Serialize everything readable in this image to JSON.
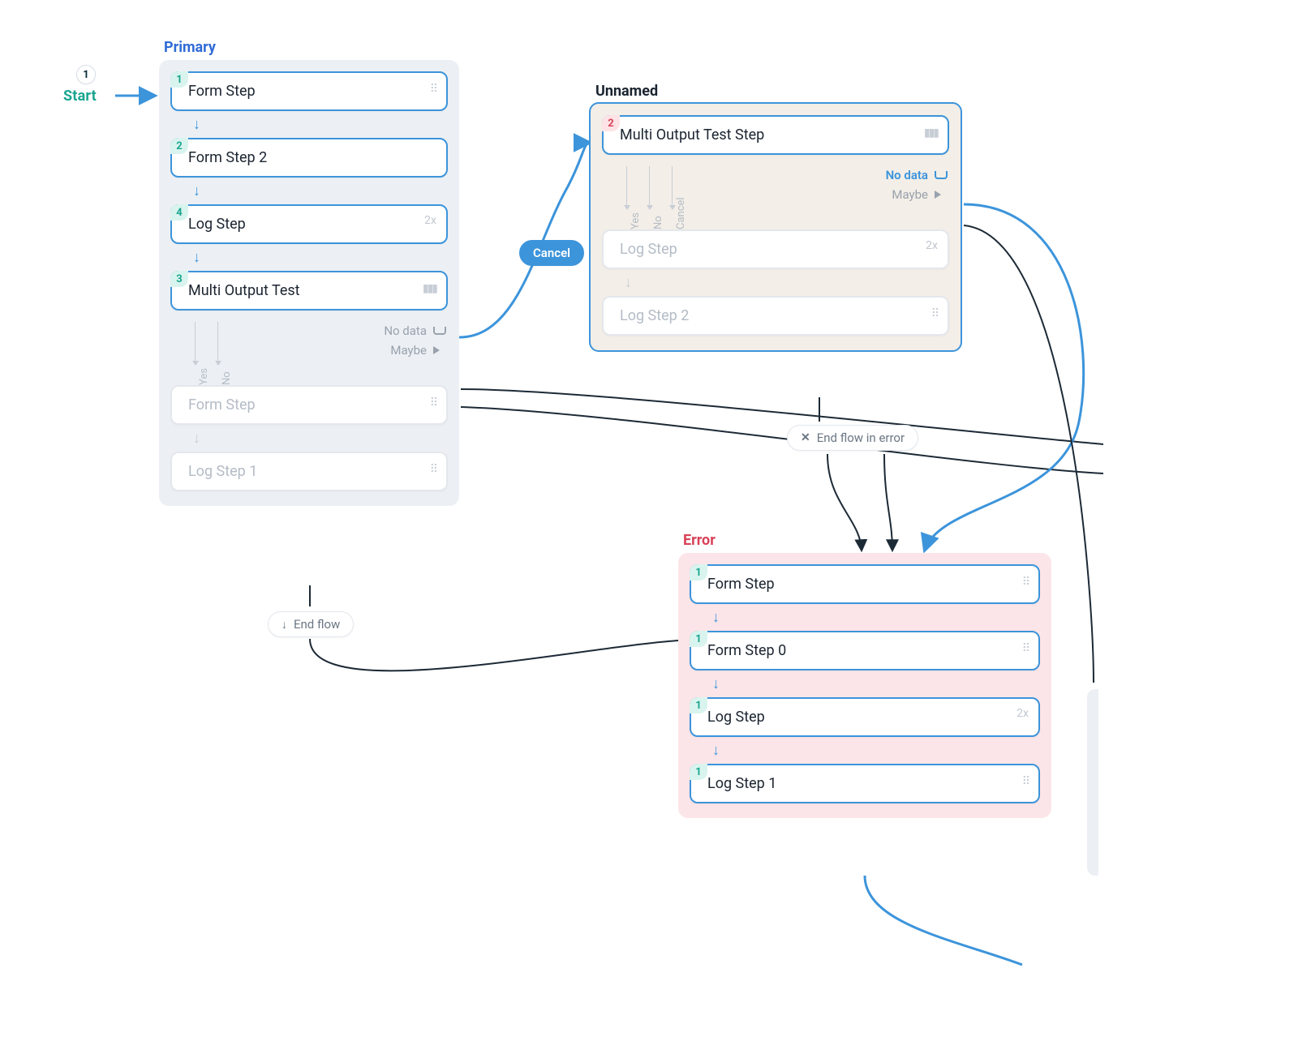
{
  "start": {
    "bullet": "1",
    "label": "Start"
  },
  "lanes": {
    "primary": {
      "title": "Primary",
      "steps": [
        {
          "badge": "1",
          "badgeColor": "green",
          "label": "Form Step",
          "icon": "grip"
        },
        {
          "badge": "2",
          "badgeColor": "green",
          "label": "Form Step 2"
        },
        {
          "badge": "4",
          "badgeColor": "green",
          "label": "Log Step",
          "count": "2x"
        },
        {
          "badge": "3",
          "badgeColor": "green",
          "label": "Multi Output Test",
          "icon": "signal"
        }
      ],
      "ports": {
        "vertical": [
          "Yes",
          "No"
        ],
        "horizontal": [
          {
            "label": "No data",
            "glyph": "cup"
          },
          {
            "label": "Maybe",
            "glyph": "tri"
          }
        ]
      },
      "fadedSteps": [
        {
          "label": "Form Step",
          "icon": "grip"
        },
        {
          "label": "Log Step 1",
          "icon": "grip"
        }
      ]
    },
    "unnamed": {
      "title": "Unnamed",
      "steps": [
        {
          "badge": "2",
          "badgeColor": "red",
          "label": "Multi Output Test Step",
          "icon": "signal"
        }
      ],
      "ports": {
        "vertical": [
          "Yes",
          "No",
          "Cancel"
        ],
        "horizontal": [
          {
            "label": "No data",
            "glyph": "cup",
            "active": true
          },
          {
            "label": "Maybe",
            "glyph": "tri"
          }
        ]
      },
      "fadedSteps": [
        {
          "label": "Log Step",
          "count": "2x"
        },
        {
          "label": "Log Step 2",
          "icon": "grip"
        }
      ]
    },
    "error": {
      "title": "Error",
      "steps": [
        {
          "badge": "1",
          "badgeColor": "green",
          "label": "Form Step",
          "icon": "grip"
        },
        {
          "badge": "1",
          "badgeColor": "green",
          "label": "Form Step 0",
          "icon": "grip"
        },
        {
          "badge": "1",
          "badgeColor": "green",
          "label": "Log Step",
          "count": "2x"
        },
        {
          "badge": "1",
          "badgeColor": "green",
          "label": "Log Step 1",
          "icon": "grip"
        }
      ]
    }
  },
  "pills": {
    "cancel": "Cancel",
    "endFlow": "End flow",
    "endFlowError": "End flow in error"
  }
}
